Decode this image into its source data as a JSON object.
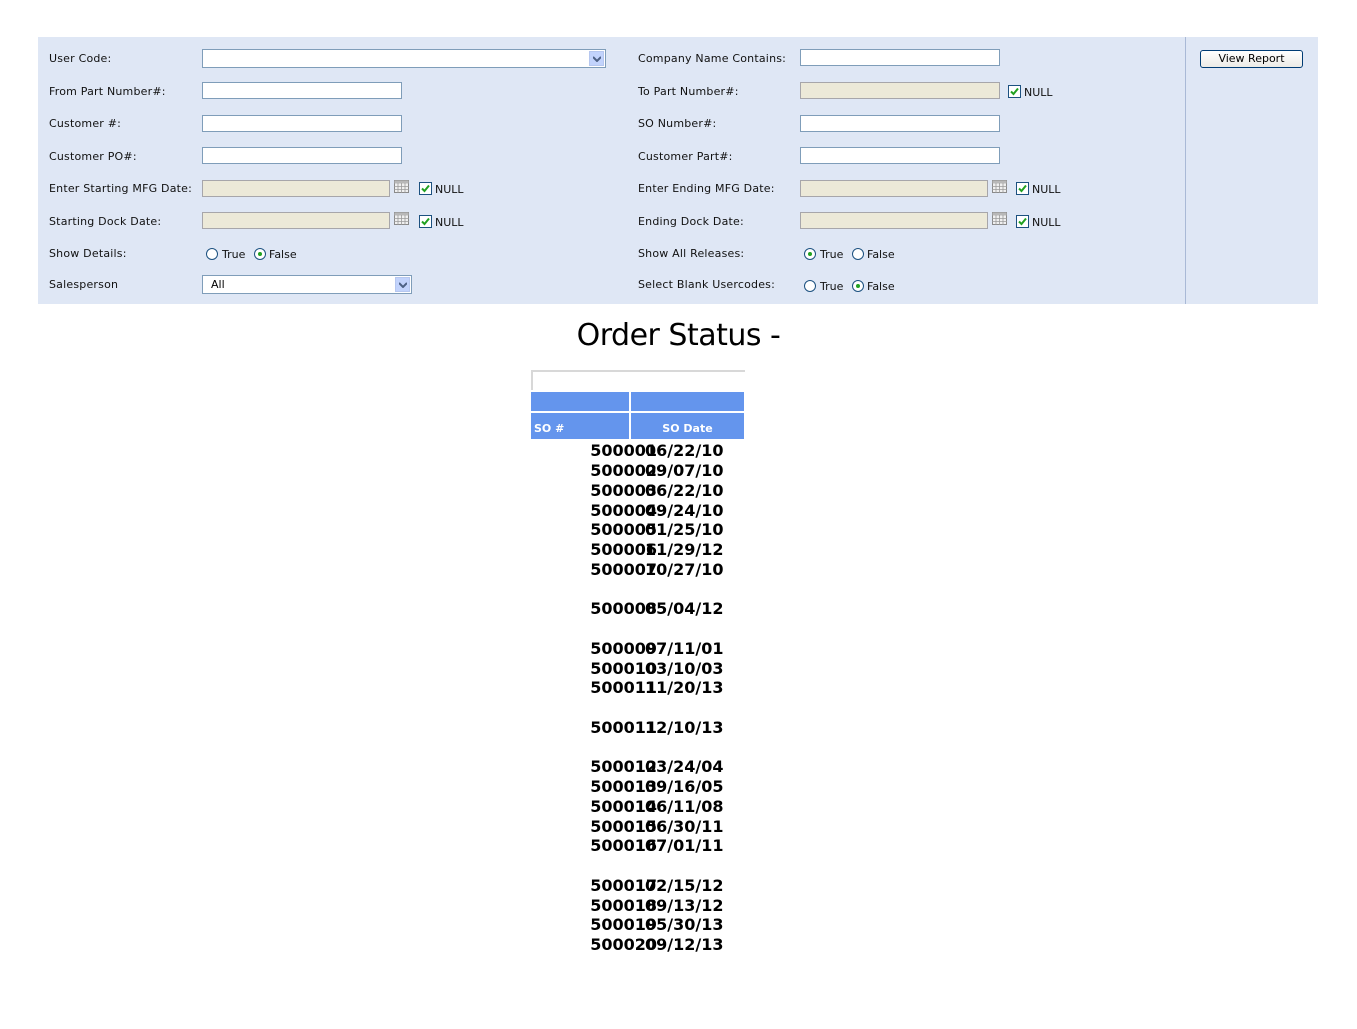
{
  "form": {
    "user_code_label": "User Code:",
    "user_code_value": "",
    "company_name_label": "Company Name Contains:",
    "company_name_value": "",
    "from_part_label": "From Part Number#:",
    "from_part_value": "",
    "to_part_label": "To Part Number#:",
    "to_part_value": "",
    "to_part_null_checked": true,
    "customer_num_label": "Customer #:",
    "customer_num_value": "",
    "so_number_label": "SO Number#:",
    "so_number_value": "",
    "customer_po_label": "Customer PO#:",
    "customer_po_value": "",
    "customer_part_label": "Customer Part#:",
    "customer_part_value": "",
    "start_mfg_label": "Enter Starting MFG Date:",
    "start_mfg_value": "",
    "start_mfg_null_checked": true,
    "end_mfg_label": "Enter Ending MFG Date:",
    "end_mfg_value": "",
    "end_mfg_null_checked": true,
    "start_dock_label": "Starting Dock Date:",
    "start_dock_value": "",
    "start_dock_null_checked": true,
    "end_dock_label": "Ending Dock Date:",
    "end_dock_value": "",
    "end_dock_null_checked": true,
    "null_label": "NULL",
    "show_details_label": "Show Details:",
    "show_details_value": "False",
    "show_all_releases_label": "Show All Releases:",
    "show_all_releases_value": "True",
    "salesperson_label": "Salesperson",
    "salesperson_value": "All",
    "blank_usercodes_label": "Select Blank Usercodes:",
    "blank_usercodes_value": "False",
    "true_label": "True",
    "false_label": "False",
    "view_report_label": "View Report"
  },
  "report": {
    "title": "Order Status -",
    "columns": [
      "SO #",
      "SO Date"
    ],
    "rows": [
      {
        "so": "500001",
        "date": "06/22/10"
      },
      {
        "so": "500002",
        "date": "09/07/10"
      },
      {
        "so": "500003",
        "date": "06/22/10"
      },
      {
        "so": "500004",
        "date": "09/24/10"
      },
      {
        "so": "500005",
        "date": "01/25/10"
      },
      {
        "so": "500006",
        "date": "11/29/12"
      },
      {
        "so": "500007",
        "date": "10/27/10"
      },
      {
        "so": "500008",
        "date": "05/04/12"
      },
      {
        "so": "500009",
        "date": "07/11/01"
      },
      {
        "so": "500010",
        "date": "03/10/03"
      },
      {
        "so": "500011",
        "date": "11/20/13"
      },
      {
        "so": "500011",
        "date": "12/10/13"
      },
      {
        "so": "500012",
        "date": "03/24/04"
      },
      {
        "so": "500013",
        "date": "09/16/05"
      },
      {
        "so": "500014",
        "date": "06/11/08"
      },
      {
        "so": "500015",
        "date": "06/30/11"
      },
      {
        "so": "500016",
        "date": "07/01/11"
      },
      {
        "so": "500017",
        "date": "02/15/12"
      },
      {
        "so": "500018",
        "date": "09/13/12"
      },
      {
        "so": "500019",
        "date": "05/30/13"
      },
      {
        "so": "500020",
        "date": "09/12/13"
      }
    ]
  }
}
